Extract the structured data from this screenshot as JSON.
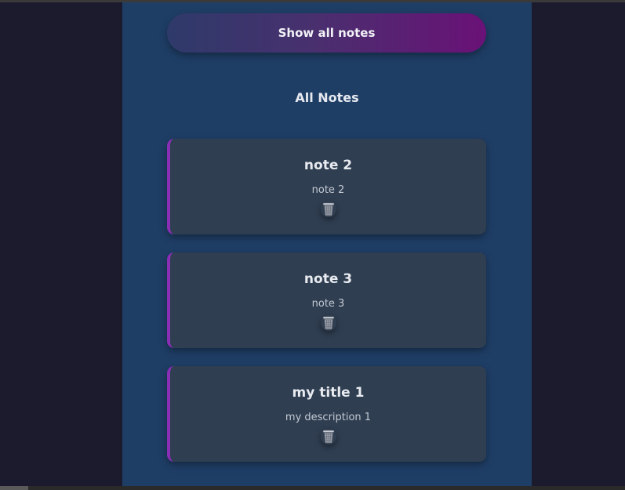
{
  "actions": {
    "show_all_label": "Show all notes"
  },
  "section": {
    "title": "All Notes"
  },
  "notes": [
    {
      "title": "note 2",
      "description": "note 2"
    },
    {
      "title": "note 3",
      "description": "note 3"
    },
    {
      "title": "my title 1",
      "description": "my description 1"
    }
  ],
  "icons": {
    "delete": "trash-icon"
  },
  "colors": {
    "page_background": "#1b1b2d",
    "panel_background": "#1f3e66",
    "card_background": "#2f3e51",
    "card_accent": "#8a2eb5",
    "button_gradient_start": "#2e3a6a",
    "button_gradient_end": "#6a1177"
  }
}
